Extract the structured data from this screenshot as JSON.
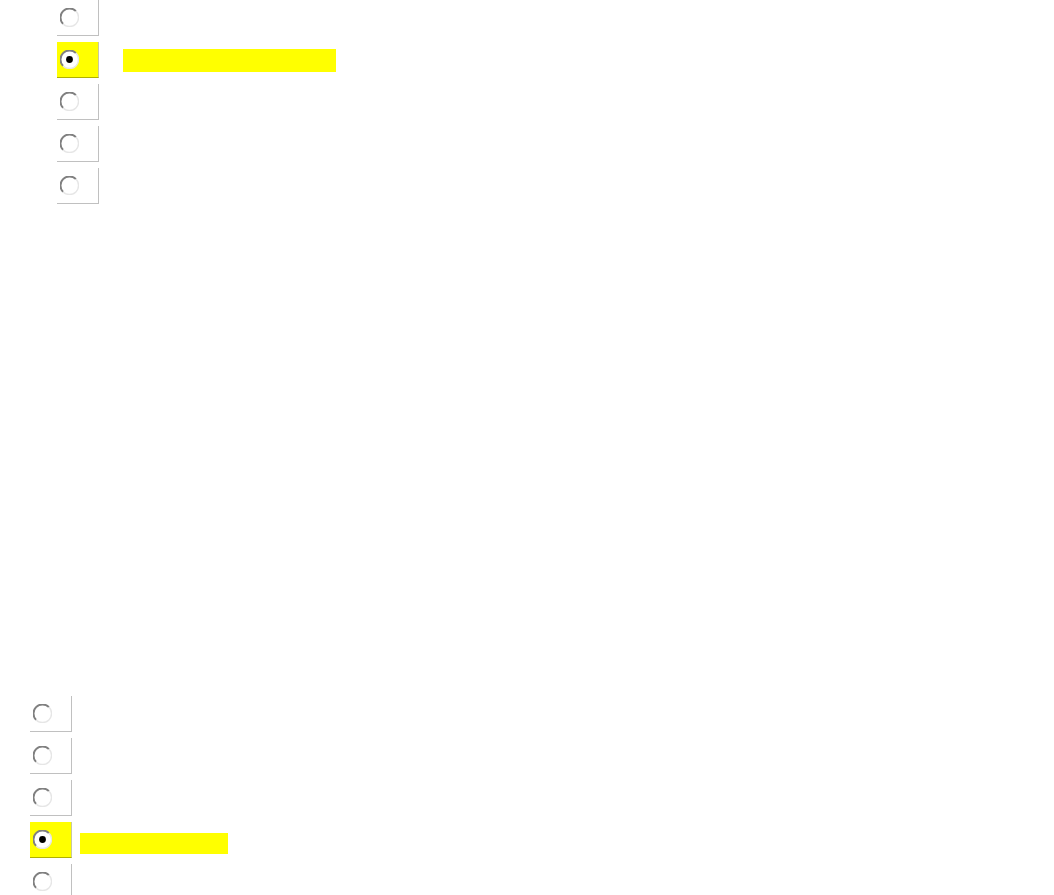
{
  "question_groups": [
    {
      "options": [
        {
          "selected": false
        },
        {
          "selected": true
        },
        {
          "selected": false
        },
        {
          "selected": false
        },
        {
          "selected": false
        }
      ]
    },
    {
      "options": [
        {
          "selected": false
        },
        {
          "selected": false
        },
        {
          "selected": false
        },
        {
          "selected": true
        },
        {
          "selected": false
        }
      ]
    }
  ]
}
